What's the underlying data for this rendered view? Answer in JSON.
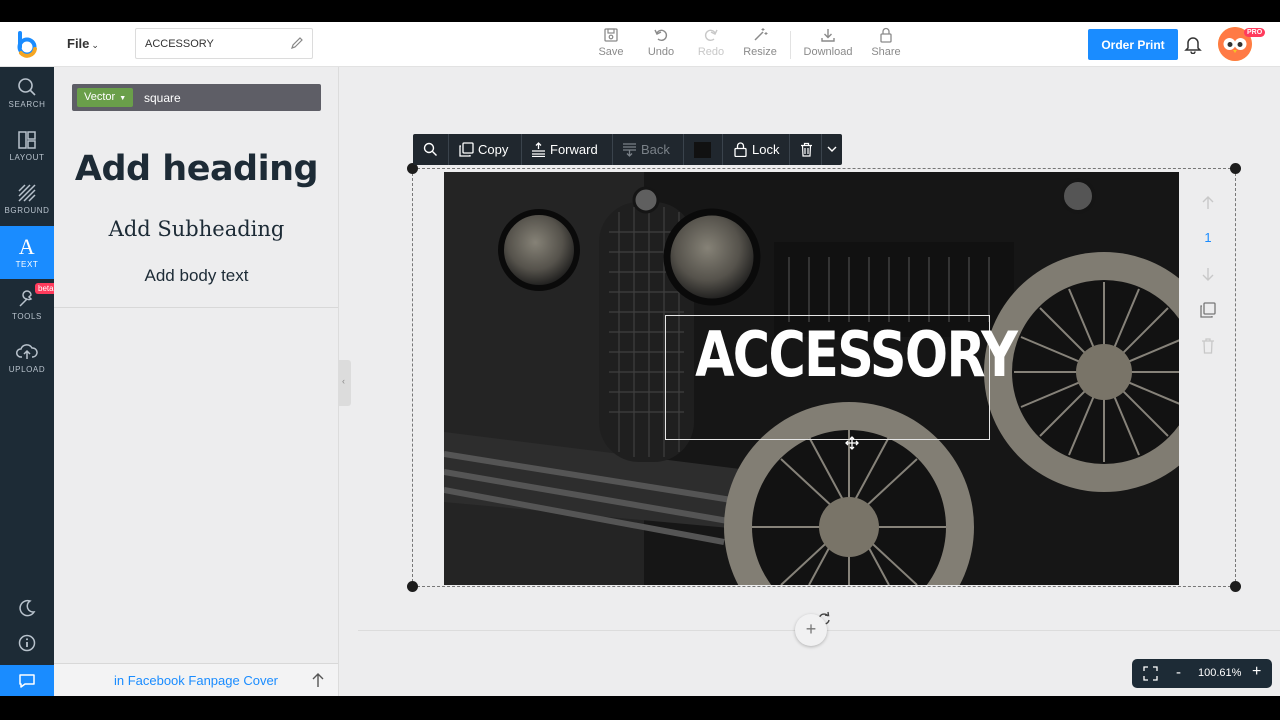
{
  "header": {
    "file_menu": "File",
    "document_title": "ACCESSORY",
    "tools": {
      "save": "Save",
      "undo": "Undo",
      "redo": "Redo",
      "resize": "Resize",
      "download": "Download",
      "share": "Share"
    },
    "order_print": "Order Print",
    "pro_badge": "PRO"
  },
  "nav": {
    "search": "SEARCH",
    "layout": "LAYOUT",
    "background": "BGROUND",
    "text": "TEXT",
    "tools": "TOOLS",
    "tools_badge": "beta",
    "upload": "UPLOAD"
  },
  "panel": {
    "filter_tag": "Vector",
    "filter_query": "square",
    "add_heading": "Add heading",
    "add_subheading": "Add Subheading",
    "add_body": "Add body text",
    "footer_link": "in Facebook Fanpage Cover"
  },
  "toolbar": {
    "copy": "Copy",
    "forward": "Forward",
    "back": "Back",
    "lock": "Lock"
  },
  "canvas": {
    "headline": "ACCESSORY",
    "page_number": "1",
    "zoom": "100.61%"
  },
  "colors": {
    "accent": "#1a8cff",
    "nav_bg": "#1d2b36",
    "beta": "#ff3b5c",
    "vector_tag": "#6a9f4a"
  }
}
